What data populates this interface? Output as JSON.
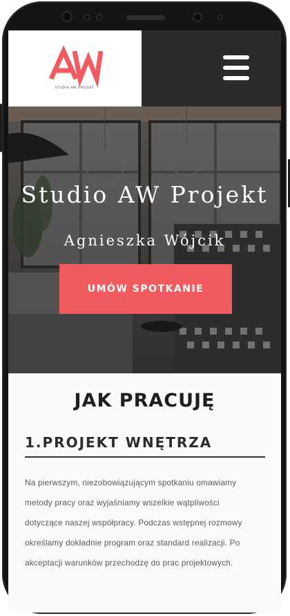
{
  "logo": {
    "mark": "AW",
    "tagline": "STUDIO AW PROJEKT",
    "color": "#f15a5f"
  },
  "header": {
    "menu_icon": "hamburger-menu-icon",
    "menu_bg": "#2b2b2b"
  },
  "hero": {
    "title": "Studio AW Projekt",
    "subtitle": "Agnieszka Wójcik",
    "cta_label": "UMÓW SPOTKANIE",
    "cta_color": "#f15a5f"
  },
  "content": {
    "section_title": "JAK PRACUJĘ",
    "step_title": "1.PROJEKT WNĘTRZA",
    "paragraph_lines": [
      "Na pierwszym, niezobowiązującym spotkaniu omawiamy",
      "metody pracy oraz wyjaśniamy wszelkie wątpliwości",
      "dotyczące naszej współpracy. Podczas wstępnej rozmowy",
      "określamy dokładnie program oraz standard realizacji. Po",
      "akceptacji warunków przechodzę do prac projektowych."
    ]
  }
}
